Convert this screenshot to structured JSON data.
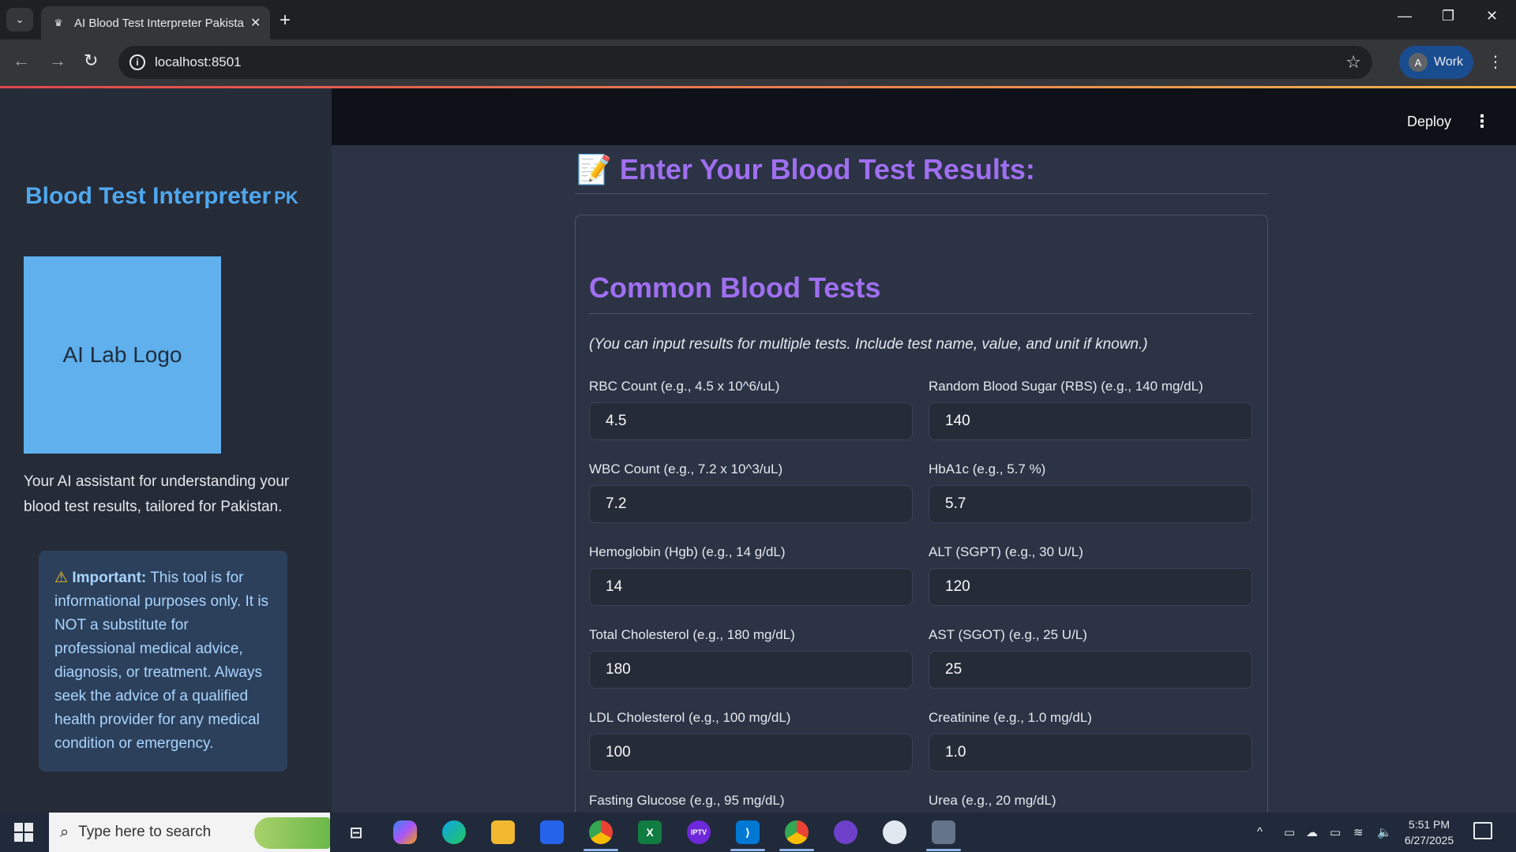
{
  "browser": {
    "tab_title": "AI Blood Test Interpreter Pakistan",
    "url": "localhost:8501",
    "profile_initial": "A",
    "profile_label": "Work"
  },
  "sidebar": {
    "title": "Blood Test Interpreter",
    "title_suffix": "PK",
    "logo_text": "AI Lab Logo",
    "tagline": "Your AI assistant for understanding your blood test results, tailored for Pakistan.",
    "warning_icon": "⚠",
    "warning_strong": "Important:",
    "warning_text": " This tool is for informational purposes only. It is NOT a substitute for professional medical advice, diagnosis, or treatment. Always seek the advice of a qualified health provider for any medical condition or emergency."
  },
  "header": {
    "deploy_label": "Deploy",
    "menu_icon": "⋮"
  },
  "main": {
    "heading_icon": "📝",
    "heading": "Enter Your Blood Test Results:",
    "section_heading": "Common Blood Tests",
    "hint": "(You can input results for multiple tests. Include test name, value, and unit if known.)",
    "left_fields": [
      {
        "label": "RBC Count (e.g., 4.5 x 10^6/uL)",
        "value": "4.5"
      },
      {
        "label": "WBC Count (e.g., 7.2 x 10^3/uL)",
        "value": "7.2"
      },
      {
        "label": "Hemoglobin (Hgb) (e.g., 14 g/dL)",
        "value": "14"
      },
      {
        "label": "Total Cholesterol (e.g., 180 mg/dL)",
        "value": "180"
      },
      {
        "label": "LDL Cholesterol (e.g., 100 mg/dL)",
        "value": "100"
      },
      {
        "label": "Fasting Glucose (e.g., 95 mg/dL)",
        "value": ""
      }
    ],
    "right_fields": [
      {
        "label": "Random Blood Sugar (RBS) (e.g., 140 mg/dL)",
        "value": "140"
      },
      {
        "label": "HbA1c (e.g., 5.7 %)",
        "value": "5.7"
      },
      {
        "label": "ALT (SGPT) (e.g., 30 U/L)",
        "value": "120"
      },
      {
        "label": "AST (SGOT) (e.g., 25 U/L)",
        "value": "25"
      },
      {
        "label": "Creatinine (e.g., 1.0 mg/dL)",
        "value": "1.0"
      },
      {
        "label": "Urea (e.g., 20 mg/dL)",
        "value": ""
      }
    ]
  },
  "taskbar": {
    "search_placeholder": "Type here to search",
    "time": "5:51 PM",
    "date": "6/27/2025",
    "iptv_label": "IPTV"
  }
}
